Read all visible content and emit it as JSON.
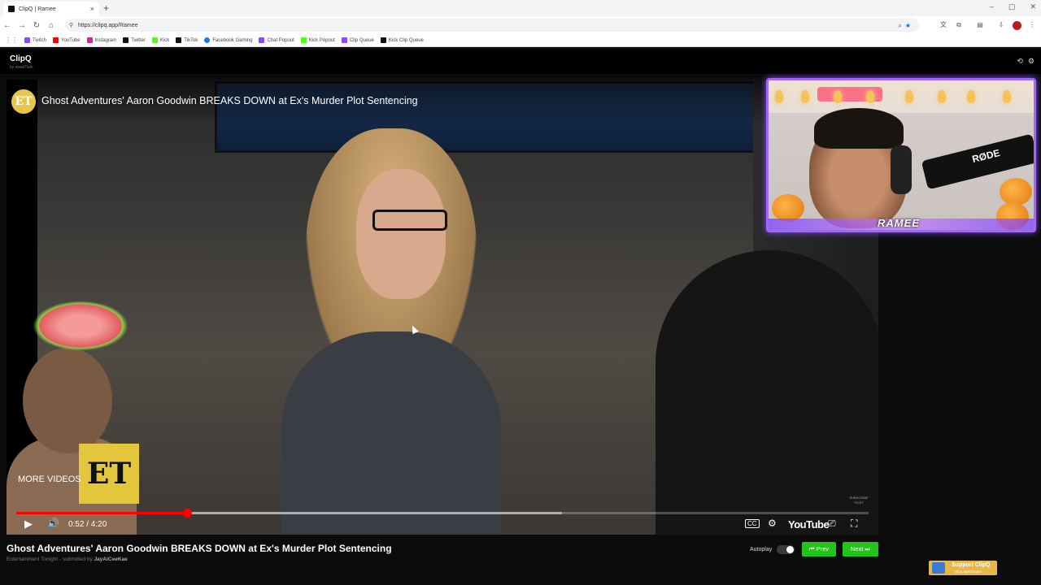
{
  "browser": {
    "tab_title": "ClipQ | Ramee",
    "tab_close": "×",
    "new_tab": "+",
    "window_controls": [
      "–",
      "▢",
      "✕"
    ],
    "url": "https://clipq.app/Ramee",
    "bookmarks": [
      {
        "label": "Twitch",
        "color": "#9146ff"
      },
      {
        "label": "YouTube",
        "color": "#ff0000"
      },
      {
        "label": "Instagram",
        "color": "#d6249f"
      },
      {
        "label": "Twitter",
        "color": "#111111"
      },
      {
        "label": "Kick",
        "color": "#53fc18"
      },
      {
        "label": "TikTok",
        "color": "#111111"
      },
      {
        "label": "Facebook Gaming",
        "color": "#1877f2"
      },
      {
        "label": "Chat Popout",
        "color": "#9146ff"
      },
      {
        "label": "Kick Popout",
        "color": "#53fc18"
      },
      {
        "label": "Clip Queue",
        "color": "#9146ff"
      },
      {
        "label": "Kick Clip Queue",
        "color": "#111111"
      }
    ]
  },
  "app": {
    "brand": "ClipQ",
    "brand_sub": "by awaitTask",
    "history_icon": "⟲",
    "settings_icon": "⚙"
  },
  "player": {
    "channel_logo": "ET",
    "title": "Ghost Adventures' Aaron Goodwin BREAKS DOWN at Ex's Murder Plot Sentencing",
    "more_videos": "MORE VIDEOS",
    "end_card_logo": "ET",
    "watermark": "SUBSCRIBE TO ET",
    "time": "0:52 / 4:20",
    "progress_fraction": 0.2,
    "buffer_fraction": 0.64,
    "youtube_wordmark": "YouTube",
    "play_icon": "▶",
    "volume_icon": "🔊",
    "cc_icon": "CC",
    "settings_icon": "⚙",
    "cast_icon": "⎚",
    "fullscreen_icon": "⛶"
  },
  "webcam": {
    "name": "RAMEE",
    "mic_brand": "RØDE"
  },
  "video_info": {
    "title": "Ghost Adventures' Aaron Goodwin BREAKS DOWN at Ex's Murder Plot Sentencing",
    "channel": "Entertainment Tonight",
    "submitted_prefix": " - submitted by ",
    "submitter": "JayAiCeeKae"
  },
  "controls": {
    "autoplay_label": "Autoplay",
    "autoplay_on": false,
    "prev_label": "⏮ Prev",
    "next_label": "Next ⏭"
  },
  "support": {
    "label": "Support ClipQ",
    "sub": "clipq.app/donate"
  }
}
